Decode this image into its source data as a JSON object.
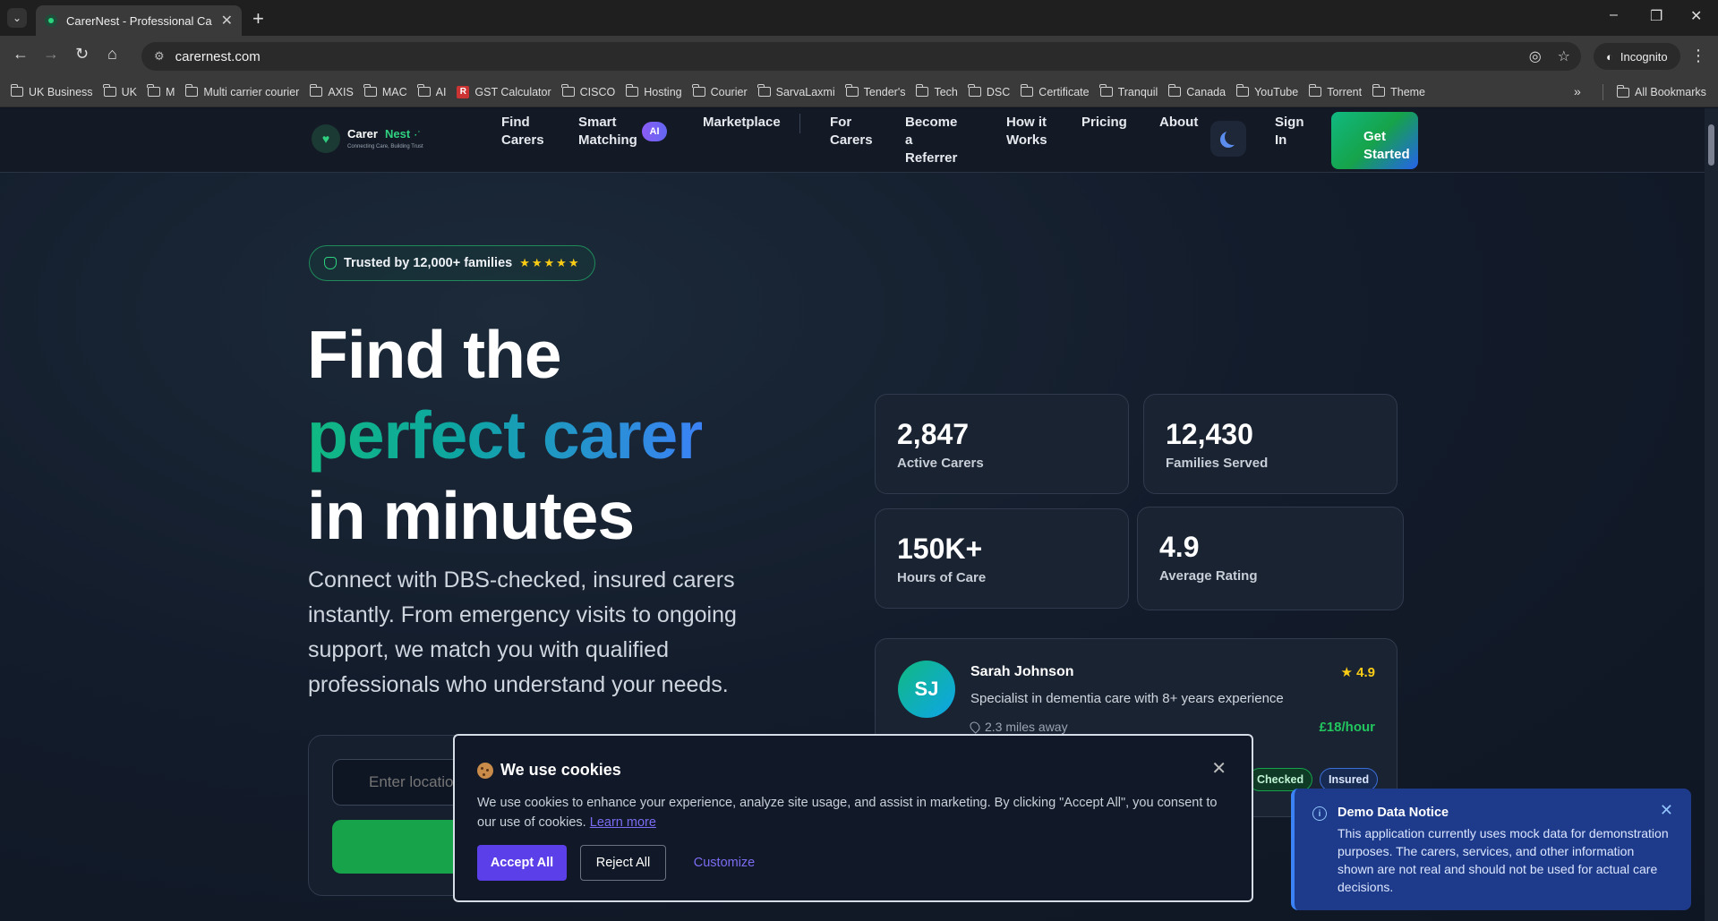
{
  "browser": {
    "tab_title": "CarerNest - Professional Care M",
    "url": "carernest.com",
    "profile": "Incognito",
    "bookmarks": [
      "UK Business",
      "UK",
      "M",
      "Multi carrier courier",
      "AXIS",
      "MAC",
      "AI",
      "GST Calculator",
      "CISCO",
      "Hosting",
      "Courier",
      "SarvaLaxmi",
      "Tender's",
      "Tech",
      "DSC",
      "Certificate",
      "Tranquil",
      "Canada",
      "YouTube",
      "Torrent",
      "Theme"
    ],
    "all_bookmarks": "All Bookmarks"
  },
  "logo": {
    "name_a": "Carer",
    "name_b": "Nest",
    "tagline": "Connecting Care, Building Trust"
  },
  "nav": {
    "find_carers": "Find Carers",
    "smart_matching": "Smart Matching",
    "ai_badge": "AI",
    "marketplace": "Marketplace",
    "for_carers": "For Carers",
    "become_referrer": "Become a Referrer",
    "how_it_works": "How it Works",
    "pricing": "Pricing",
    "about": "About",
    "sign_in": "Sign In",
    "get_started": "Get Started"
  },
  "hero": {
    "trust_badge": "Trusted by 12,000+ families",
    "stars": "★★★★★",
    "headline_1": "Find the",
    "headline_2": "perfect carer",
    "headline_3": "in minutes",
    "subtext": "Connect with DBS-checked, insured carers instantly. From emergency visits to ongoing support, we match you with qualified professionals who understand your needs.",
    "location_placeholder": "Enter location"
  },
  "stats": [
    {
      "value": "2,847",
      "label": "Active Carers"
    },
    {
      "value": "12,430",
      "label": "Families Served"
    },
    {
      "value": "150K+",
      "label": "Hours of Care"
    },
    {
      "value": "4.9",
      "label": "Average Rating"
    }
  ],
  "carer": {
    "initials": "SJ",
    "name": "Sarah Johnson",
    "rating": "4.9",
    "description": "Specialist in dementia care with 8+ years experience",
    "distance": "2.3 miles away",
    "rate": "£18/hour",
    "tags": [
      "Checked",
      "Insured"
    ]
  },
  "cookie": {
    "title": "We use cookies",
    "text": "We use cookies to enhance your experience, analyze site usage, and assist in marketing. By clicking \"Accept All\", you consent to our use of cookies.",
    "learn_more": "Learn more",
    "accept": "Accept All",
    "reject": "Reject All",
    "customize": "Customize"
  },
  "notice": {
    "title": "Demo Data Notice",
    "text": "This application currently uses mock data for demonstration purposes. The carers, services, and other information shown are not real and should not be used for actual care decisions."
  },
  "colors": {
    "accent_green": "#10b981",
    "accent_blue": "#3b82f6",
    "cookie_primary": "#5b3fe8",
    "background": "#0f1623"
  }
}
